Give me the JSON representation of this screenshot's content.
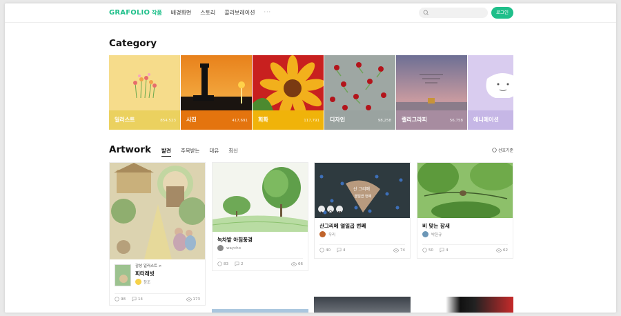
{
  "header": {
    "logo": "GRAFOLIO",
    "nav": [
      "작품",
      "배경화면",
      "스토리",
      "콜라보레이션"
    ],
    "more": "···",
    "login_label": "로그인"
  },
  "category": {
    "title": "Category",
    "items": [
      {
        "name": "일러스트",
        "count": "854,523",
        "bar_color": "#e9cf5b"
      },
      {
        "name": "사진",
        "count": "417,691",
        "bar_color": "#e4740e"
      },
      {
        "name": "회화",
        "count": "117,791",
        "bar_color": "#f0b30a"
      },
      {
        "name": "디자인",
        "count": "98,258",
        "bar_color": "#9aa3a0"
      },
      {
        "name": "캘리그라피",
        "count": "56,758",
        "bar_color": "#a78ca0"
      },
      {
        "name": "애니메이션",
        "count": "",
        "bar_color": "#c6b7e6"
      }
    ]
  },
  "artwork": {
    "title": "Artwork",
    "tabs": [
      "발견",
      "주목받는",
      "대유",
      "최신"
    ],
    "sort_label": "선호기준",
    "cards": [
      {
        "series_category": "감성 일러스트 >",
        "series_title": "피터래빗",
        "author": "창조",
        "likes": "98",
        "comments": "14",
        "views": "173"
      },
      {
        "title": "녹차밭 아침풍경",
        "author": "waycho",
        "likes": "83",
        "comments": "2",
        "views": "66"
      },
      {
        "title": "산그리메 열일곱 번째",
        "author": "우리",
        "likes": "40",
        "comments": "4",
        "views": "74",
        "overlay_text_1": "산 그리메",
        "overlay_text_2": "열일곱 번째"
      },
      {
        "title": "비 맞는 잠새",
        "author": "박한규",
        "likes": "50",
        "comments": "4",
        "views": "62"
      }
    ]
  },
  "icons": [
    "search-icon",
    "like-icon",
    "comment-icon",
    "view-icon",
    "play-icon",
    "sort-icon"
  ]
}
